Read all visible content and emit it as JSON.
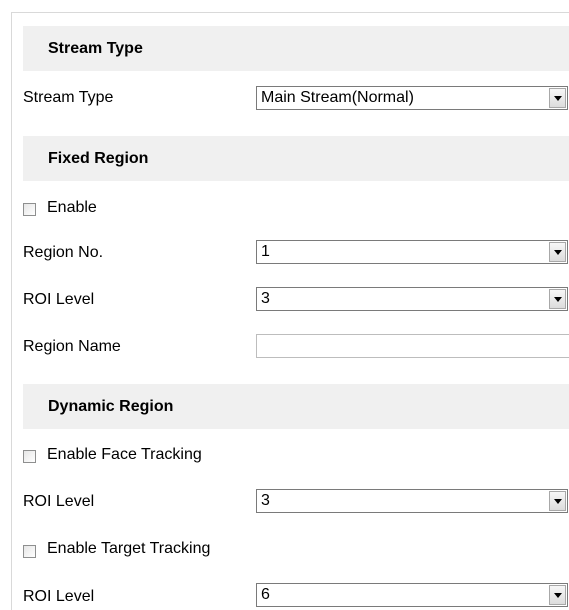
{
  "stream_section": {
    "title": "Stream Type",
    "stream_type_label": "Stream Type",
    "stream_type_value": "Main Stream(Normal)"
  },
  "fixed_section": {
    "title": "Fixed Region",
    "enable_label": "Enable",
    "enable_checked": false,
    "region_no_label": "Region No.",
    "region_no_value": "1",
    "roi_level_label": "ROI Level",
    "roi_level_value": "3",
    "region_name_label": "Region Name",
    "region_name_value": ""
  },
  "dynamic_section": {
    "title": "Dynamic Region",
    "face_tracking_label": "Enable Face Tracking",
    "face_tracking_checked": false,
    "face_roi_level_label": "ROI Level",
    "face_roi_level_value": "3",
    "target_tracking_label": "Enable Target Tracking",
    "target_tracking_checked": false,
    "target_roi_level_label": "ROI Level",
    "target_roi_level_value": "6"
  }
}
